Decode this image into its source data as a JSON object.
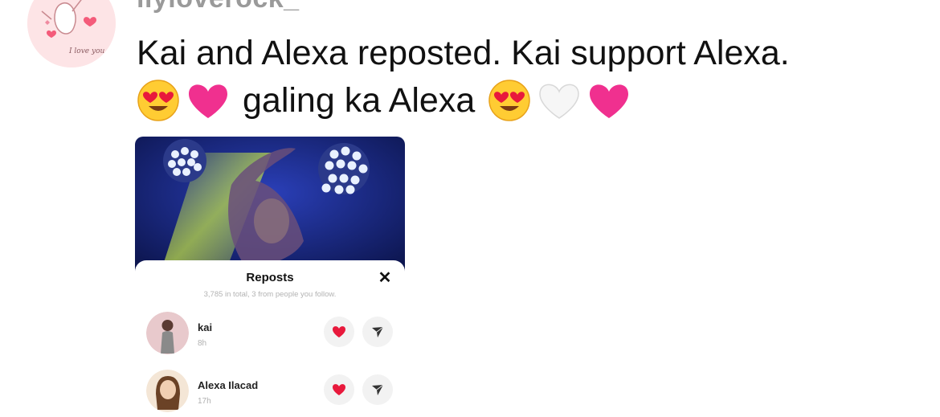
{
  "post": {
    "username": "ilyloverock_",
    "avatar_caption": "I love you",
    "text_line1": "Kai and Alexa reposted. Kai support Alexa.",
    "text_line2": "galing ka Alexa",
    "emojis_line2": [
      "heart-eyes-emoji",
      "pink-heart-emoji",
      "heart-eyes-emoji",
      "white-heart-emoji",
      "pink-heart-emoji"
    ]
  },
  "embed": {
    "sheet_title": "Reposts",
    "close_label": "✕",
    "subtitle": "3,785 in total, 3 from people you follow.",
    "reposters": [
      {
        "name": "kai",
        "time": "8h"
      },
      {
        "name": "Alexa Ilacad",
        "time": "17h"
      }
    ]
  },
  "colors": {
    "heart": "#e8193c",
    "avatar_bg": "#fde4e6",
    "video_blue": "#1f2e8c"
  }
}
